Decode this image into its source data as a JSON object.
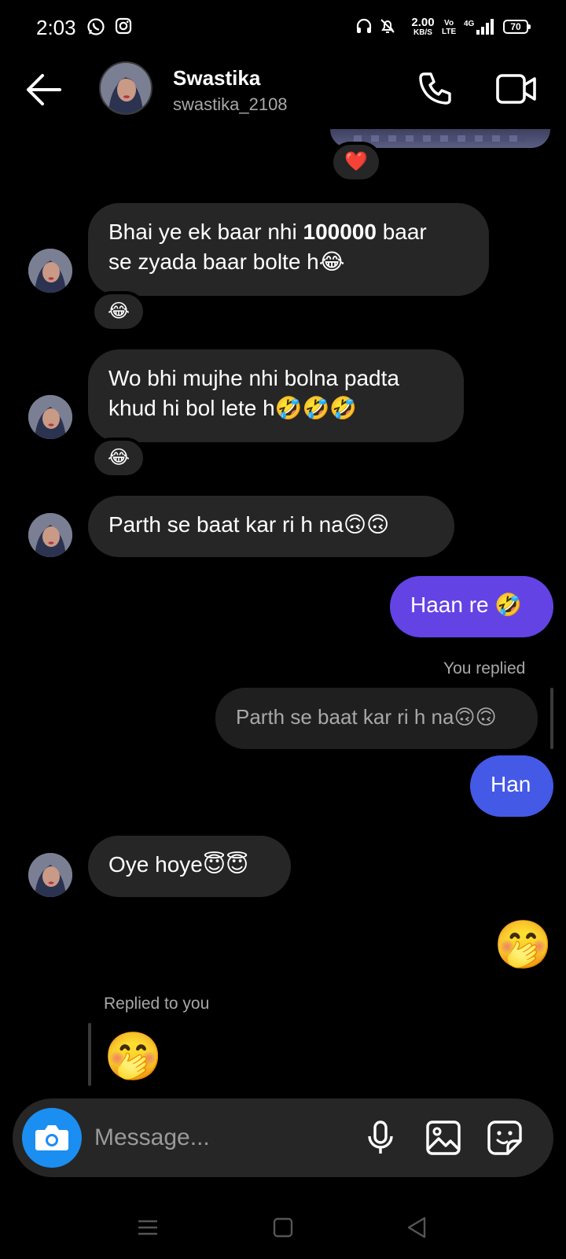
{
  "status_bar": {
    "time": "2:03",
    "speed_value": "2.00",
    "speed_unit": "KB/S",
    "volte_top": "Vo",
    "volte_bottom": "LTE",
    "network": "4G",
    "battery": "70"
  },
  "header": {
    "name": "Swastika",
    "username": "swastika_2108"
  },
  "messages": {
    "heart_reaction": "❤️",
    "m1_part1": "Bhai ye ek baar nhi ",
    "m1_bold": "100000",
    "m1_part2": " baar",
    "m1_line2": "se zyada baar bolte h😂",
    "m1_reaction": "😂",
    "m2_line1": "Wo bhi mujhe nhi bolna padta",
    "m2_line2": "khud hi bol lete h🤣🤣🤣",
    "m2_reaction": "😂",
    "m3": "Parth se baat kar ri h na🙃🙃",
    "m4": "Haan re 🤣",
    "you_replied": "You replied",
    "quoted_1": "Parth se baat kar ri h na🙃🙃",
    "m5": "Han",
    "m6": "Oye hoye😇😇",
    "m7": "🤭",
    "replied_to_you": "Replied to you",
    "quoted_2": "🤭"
  },
  "composer": {
    "placeholder": "Message..."
  },
  "icons": {
    "back": "back-arrow-icon",
    "call": "phone-icon",
    "video": "video-camera-icon",
    "camera": "camera-icon",
    "mic": "microphone-icon",
    "gallery": "image-icon",
    "sticker": "sticker-icon"
  },
  "colors": {
    "sent_purple": "#6443e4",
    "sent_blue": "#4459e6",
    "received": "#262626",
    "camera_button": "#1b8ef2"
  }
}
